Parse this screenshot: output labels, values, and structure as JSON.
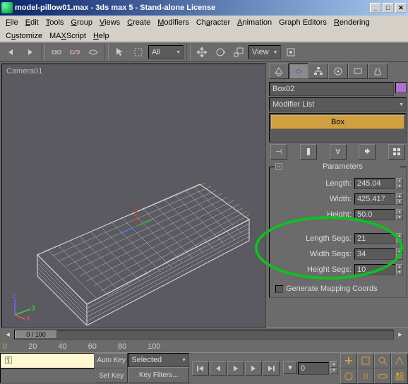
{
  "window": {
    "title": "model-pillow01.max - 3ds max 5 - Stand-alone License",
    "controls": {
      "min": "_",
      "max": "□",
      "close": "✕"
    }
  },
  "menu": {
    "file": "File",
    "edit": "Edit",
    "tools": "Tools",
    "group": "Group",
    "views": "Views",
    "create": "Create",
    "modifiers": "Modifiers",
    "character": "Character",
    "animation": "Animation",
    "graph_editors": "Graph Editors",
    "rendering": "Rendering",
    "customize": "Customize",
    "maxscript": "MAXScript",
    "help": "Help"
  },
  "toolbar": {
    "named_sel": "All",
    "view_dd": "View"
  },
  "viewport": {
    "label": "Camera01"
  },
  "cmdpanel": {
    "object_name": "Box02",
    "modifier_list": "Modifier List",
    "stack_item": "Box",
    "rollout_title": "Parameters",
    "params": {
      "length_lbl": "Length:",
      "length_val": "245.04",
      "width_lbl": "Width:",
      "width_val": "425.417",
      "height_lbl": "Height:",
      "height_val": "50.0",
      "lsegs_lbl": "Length Segs:",
      "lsegs_val": "21",
      "wsegs_lbl": "Width Segs:",
      "wsegs_val": "34",
      "hsegs_lbl": "Height Segs:",
      "hsegs_val": "10",
      "genmap_lbl": "Generate Mapping Coords"
    }
  },
  "time": {
    "scrub": "0 / 100",
    "tick0": "0",
    "tick20": "20",
    "tick40": "40",
    "tick60": "60",
    "tick80": "80",
    "tick100": "100"
  },
  "status": {
    "autokey": "Auto Key",
    "setkey": "Set Key",
    "selected": "Selected",
    "keyfilters": "Key Filters...",
    "frame": "0"
  }
}
